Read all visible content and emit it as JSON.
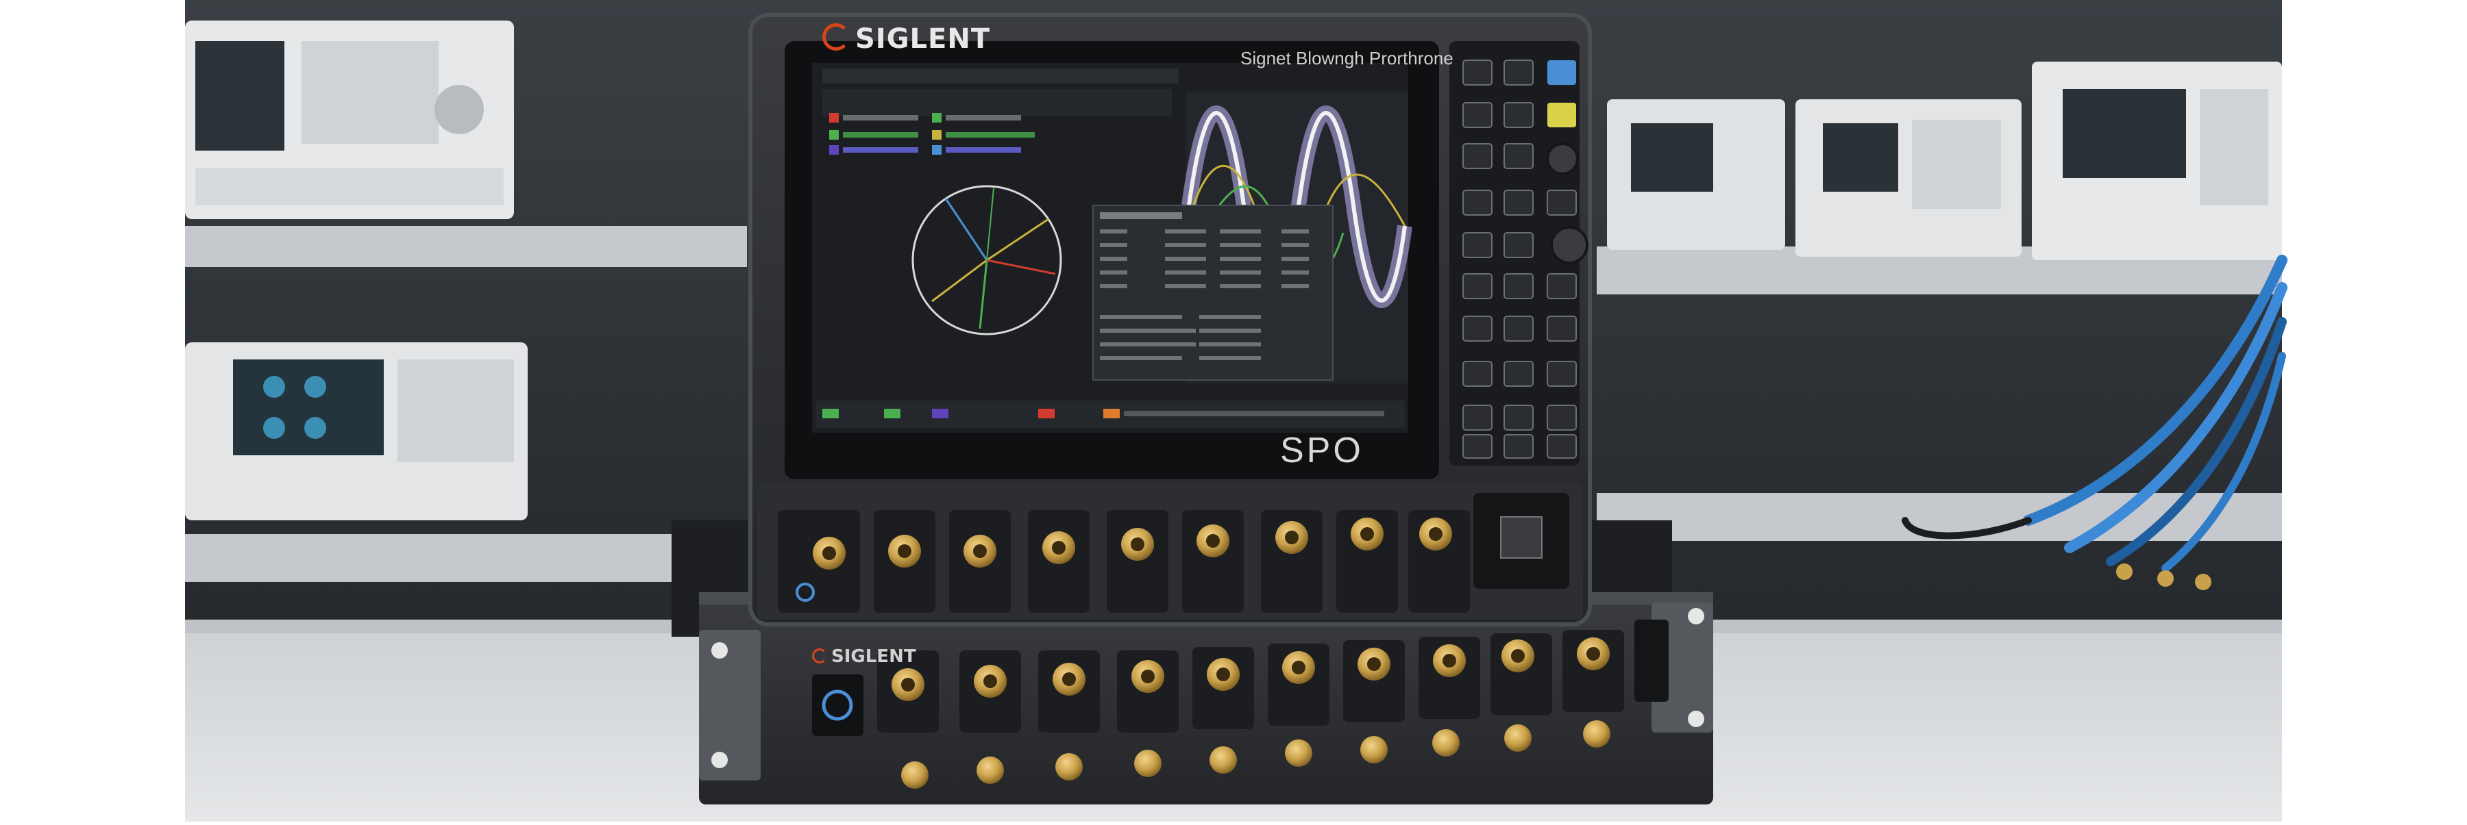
{
  "scene": {
    "description_labels": {
      "brand_primary": "SIGLENT",
      "screen_title": "Signet Blowngh Prorthrone",
      "model_mark": "SPO",
      "brand_secondary": "SIGLENT"
    },
    "colors": {
      "background_dark": "#2b2f33",
      "shelf": "#c8ccd0",
      "desk": "#d9dcdf",
      "chassis": "#2a2c2f",
      "screen": "#1c1e21",
      "connector_gold": "#c9a14a",
      "accent_blue": "#4a8fd6",
      "accent_yellow": "#d9d24a",
      "trace_white": "#f2f2f2",
      "trace_purple": "#9a8cd9",
      "trace_yellow": "#c9b23c",
      "trace_green": "#4caf50",
      "cable_blue": "#3d8bd8"
    }
  }
}
